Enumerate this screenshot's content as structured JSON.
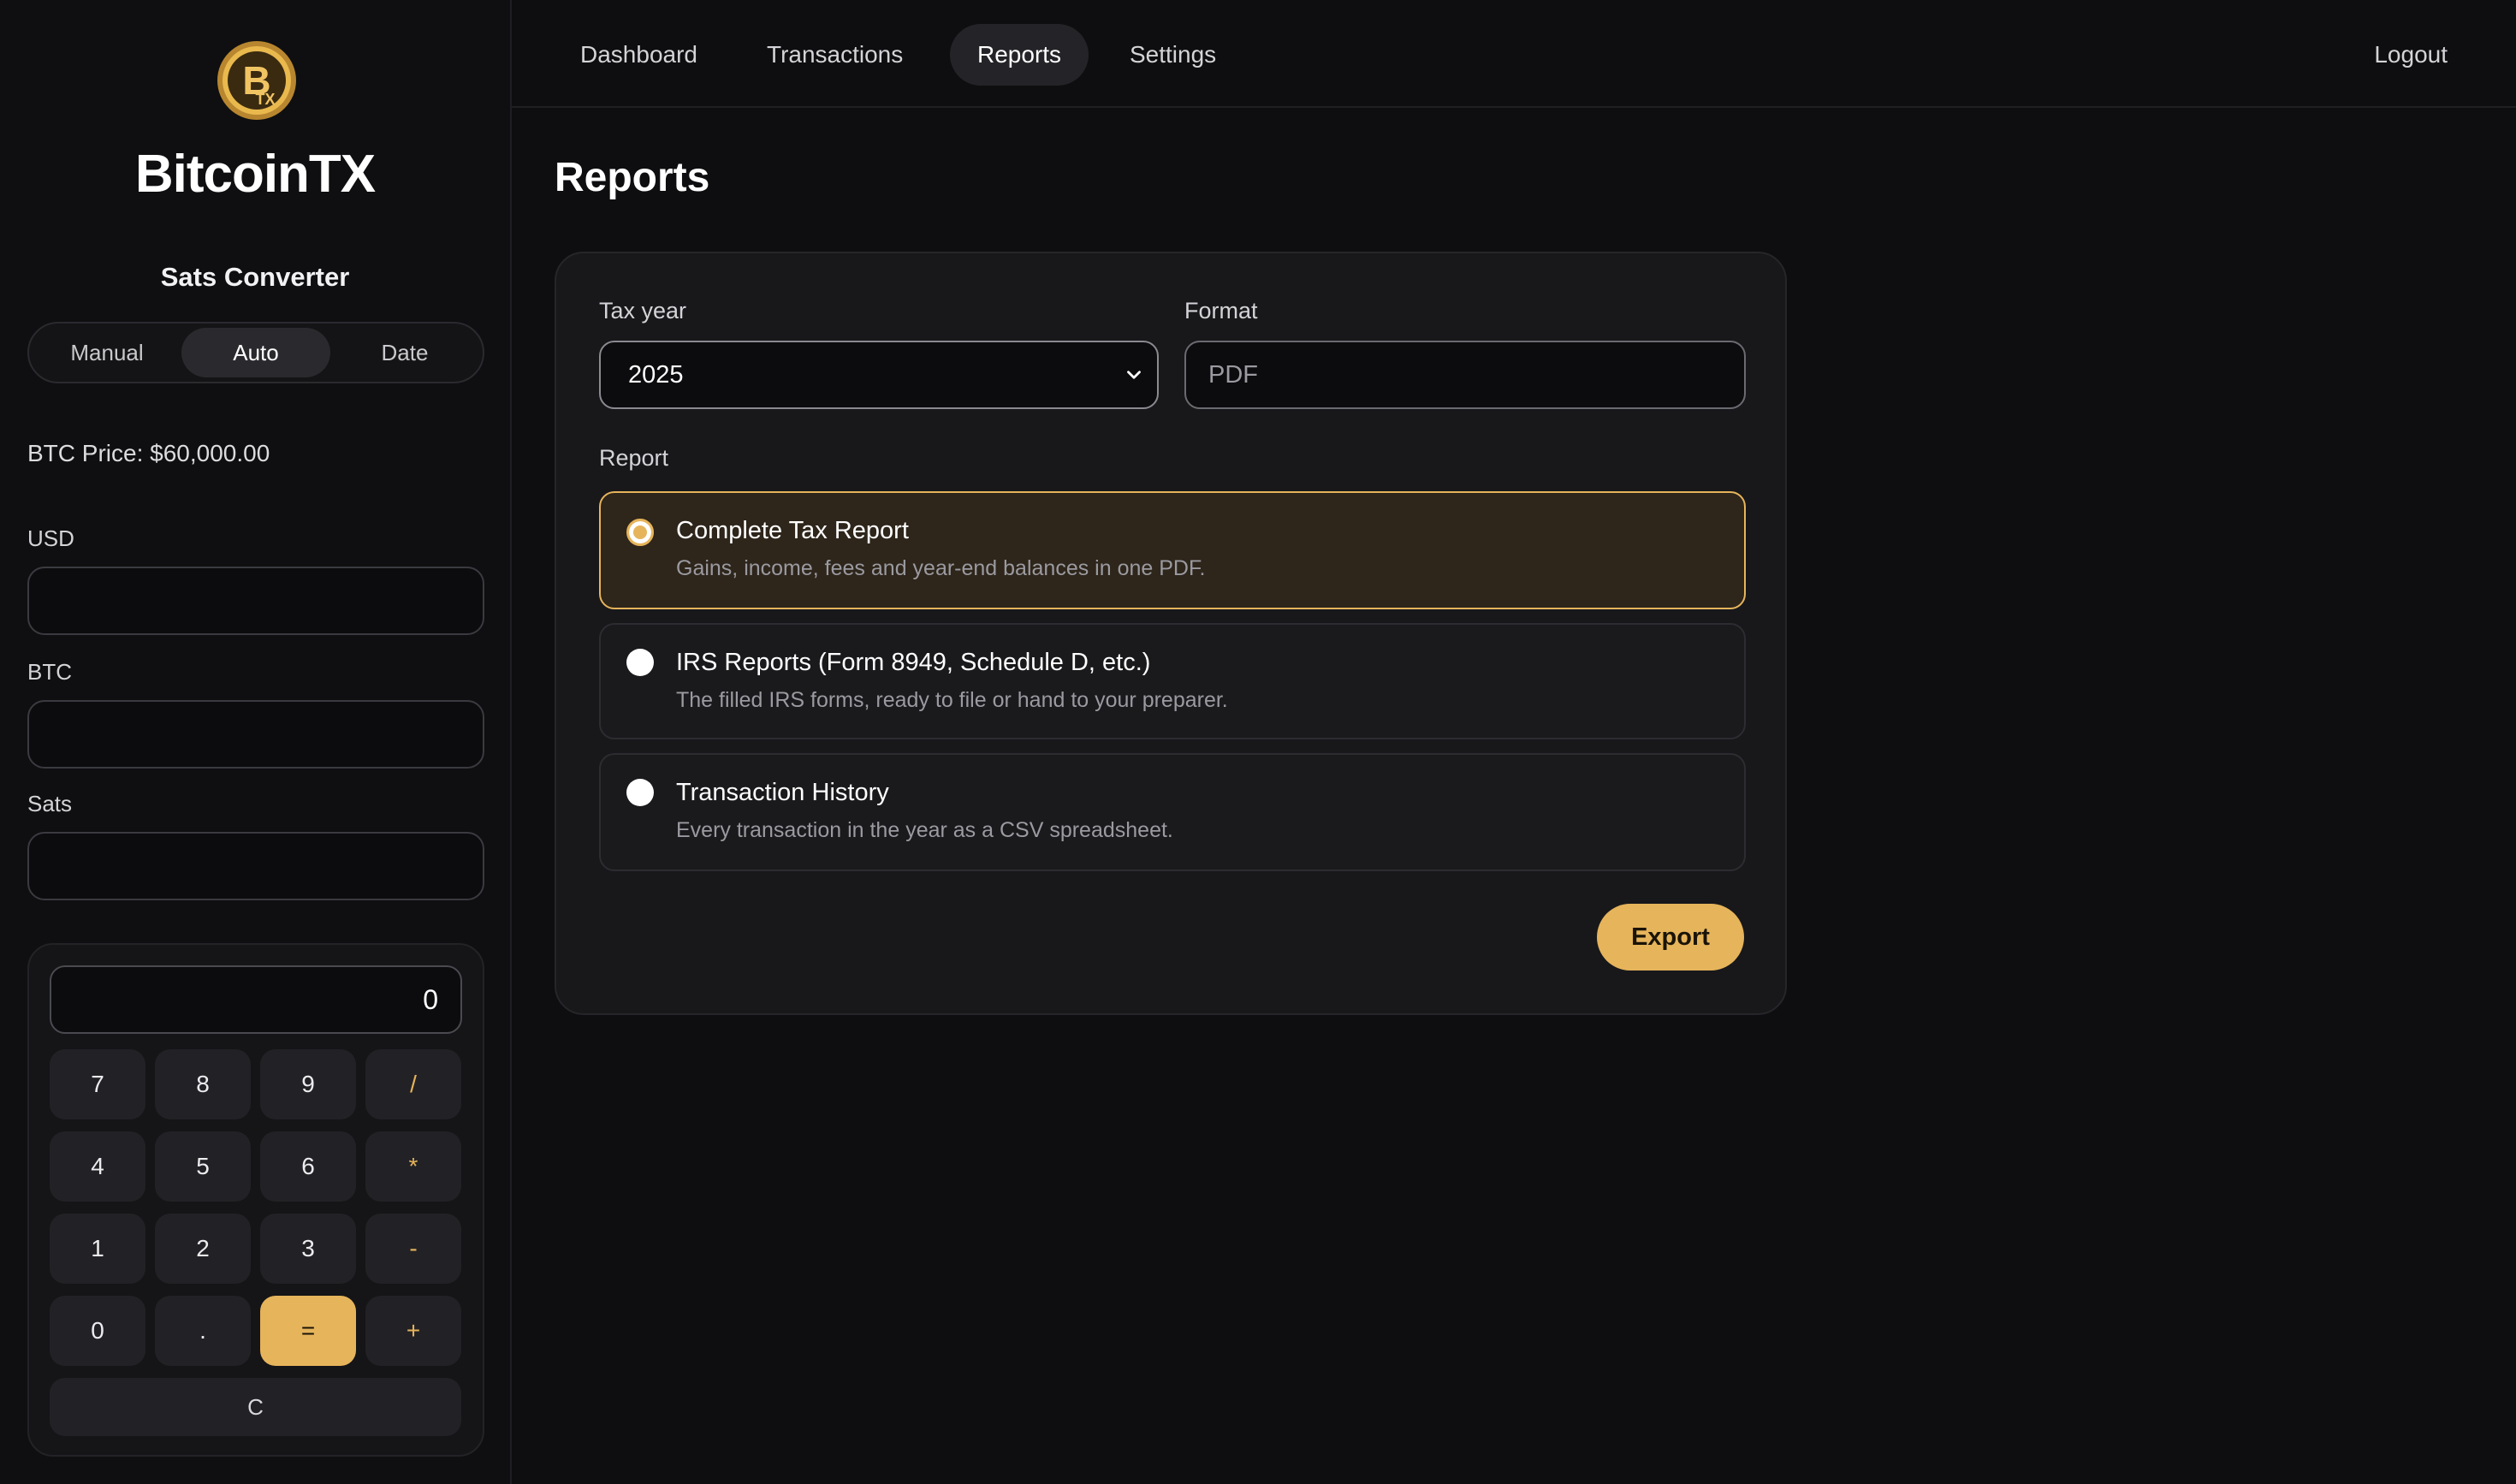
{
  "brand": {
    "name": "BitcoinTX",
    "logo_icon": "bitcoin-coin-icon",
    "logo_text": "TX",
    "accent_color": "#e6b45b"
  },
  "sidebar": {
    "converter_title": "Sats Converter",
    "modes": [
      {
        "label": "Manual",
        "active": false
      },
      {
        "label": "Auto",
        "active": true
      },
      {
        "label": "Date",
        "active": false
      }
    ],
    "btc_price": "BTC Price: $60,000.00",
    "fields": [
      {
        "label": "USD",
        "value": ""
      },
      {
        "label": "BTC",
        "value": ""
      },
      {
        "label": "Sats",
        "value": ""
      }
    ],
    "calculator": {
      "display": "0",
      "keys": [
        "7",
        "8",
        "9",
        "/",
        "4",
        "5",
        "6",
        "*",
        "1",
        "2",
        "3",
        "-",
        "0",
        ".",
        "=",
        "+"
      ],
      "clear_label": "C"
    }
  },
  "nav": {
    "items": [
      {
        "label": "Dashboard",
        "active": false
      },
      {
        "label": "Transactions",
        "active": false
      },
      {
        "label": "Reports",
        "active": true
      },
      {
        "label": "Settings",
        "active": false
      }
    ],
    "logout": "Logout"
  },
  "page": {
    "title": "Reports",
    "tax_year_label": "Tax year",
    "tax_year_value": "2025",
    "format_label": "Format",
    "format_value": "PDF",
    "report_label": "Report",
    "options": [
      {
        "title": "Complete Tax Report",
        "description": "Gains, income, fees and year-end balances in one PDF.",
        "selected": true
      },
      {
        "title": "IRS Reports (Form 8949, Schedule D, etc.)",
        "description": "The filled IRS forms, ready to file or hand to your preparer.",
        "selected": false
      },
      {
        "title": "Transaction History",
        "description": "Every transaction in the year as a CSV spreadsheet.",
        "selected": false
      }
    ],
    "export_label": "Export"
  }
}
